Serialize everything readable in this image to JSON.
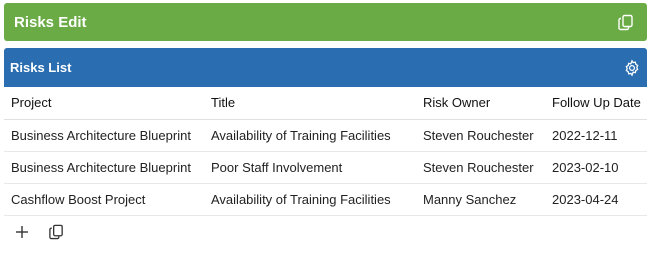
{
  "edit_panel": {
    "title": "Risks Edit",
    "copy_icon": "copy-icon",
    "color": "#6aab45"
  },
  "list_panel": {
    "title": "Risks List",
    "settings_icon": "gear-icon",
    "color": "#2a6eb1",
    "columns": [
      "Project",
      "Title",
      "Risk Owner",
      "Follow Up Date"
    ],
    "rows": [
      [
        "Business Architecture Blueprint",
        "Availability of Training Facilities",
        "Steven Rouchester",
        "2022-12-11"
      ],
      [
        "Business Architecture Blueprint",
        "Poor Staff Involvement",
        "Steven Rouchester",
        "2023-02-10"
      ],
      [
        "Cashflow Boost Project",
        "Availability of Training Facilities",
        "Manny Sanchez",
        "2023-04-24"
      ]
    ],
    "footer_icons": [
      "plus-icon",
      "copy-icon"
    ]
  }
}
